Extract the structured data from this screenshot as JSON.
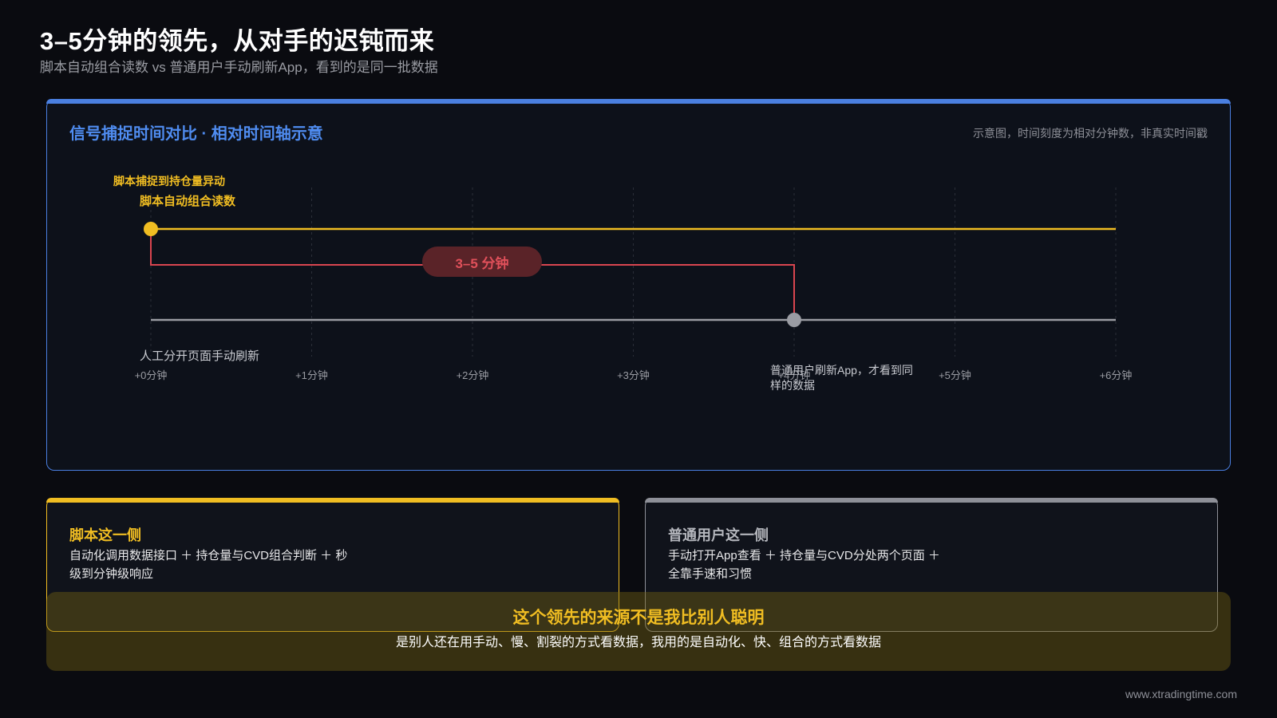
{
  "header": {
    "title": "3–5分钟的领先，从对手的迟钝而来",
    "subtitle": "脚本自动组合读数 vs 普通用户手动刷新App，看到的是同一批数据"
  },
  "panel": {
    "title": "信号捕捉时间对比 · 相对时间轴示意",
    "note": "示意图，时间刻度为相对分钟数，非真实时间戳",
    "ticks": [
      "+0分钟",
      "+1分钟",
      "+2分钟",
      "+3分钟",
      "+4分钟",
      "+5分钟",
      "+6分钟"
    ],
    "script_event_label": "脚本捕捉到持仓量异动",
    "script_line_label": "脚本自动组合读数",
    "manual_line_label": "人工分开页面手动刷新",
    "user_event_label": "普通用户刷新App，才看到同样的数据",
    "gap_label": "3–5 分钟",
    "script_event_minute": 0,
    "user_event_minute": 4,
    "timeline_end_minute": 6,
    "colors": {
      "script": "#f0bd22",
      "manual": "#9a9ca3",
      "gap": "#d9454f",
      "accent": "#4a7fe0"
    }
  },
  "cards": {
    "script_side": {
      "title": "脚本这一侧",
      "body": "自动化调用数据接口 ＋ 持仓量与CVD组合判断 ＋ 秒级到分钟级响应"
    },
    "user_side": {
      "title": "普通用户这一侧",
      "body": "手动打开App查看 ＋ 持仓量与CVD分处两个页面 ＋ 全靠手速和习惯"
    }
  },
  "conclusion": {
    "title": "这个领先的来源不是我比别人聪明",
    "subtitle": "是别人还在用手动、慢、割裂的方式看数据，我用的是自动化、快、组合的方式看数据"
  },
  "footer": {
    "url": "www.xtradingtime.com"
  }
}
